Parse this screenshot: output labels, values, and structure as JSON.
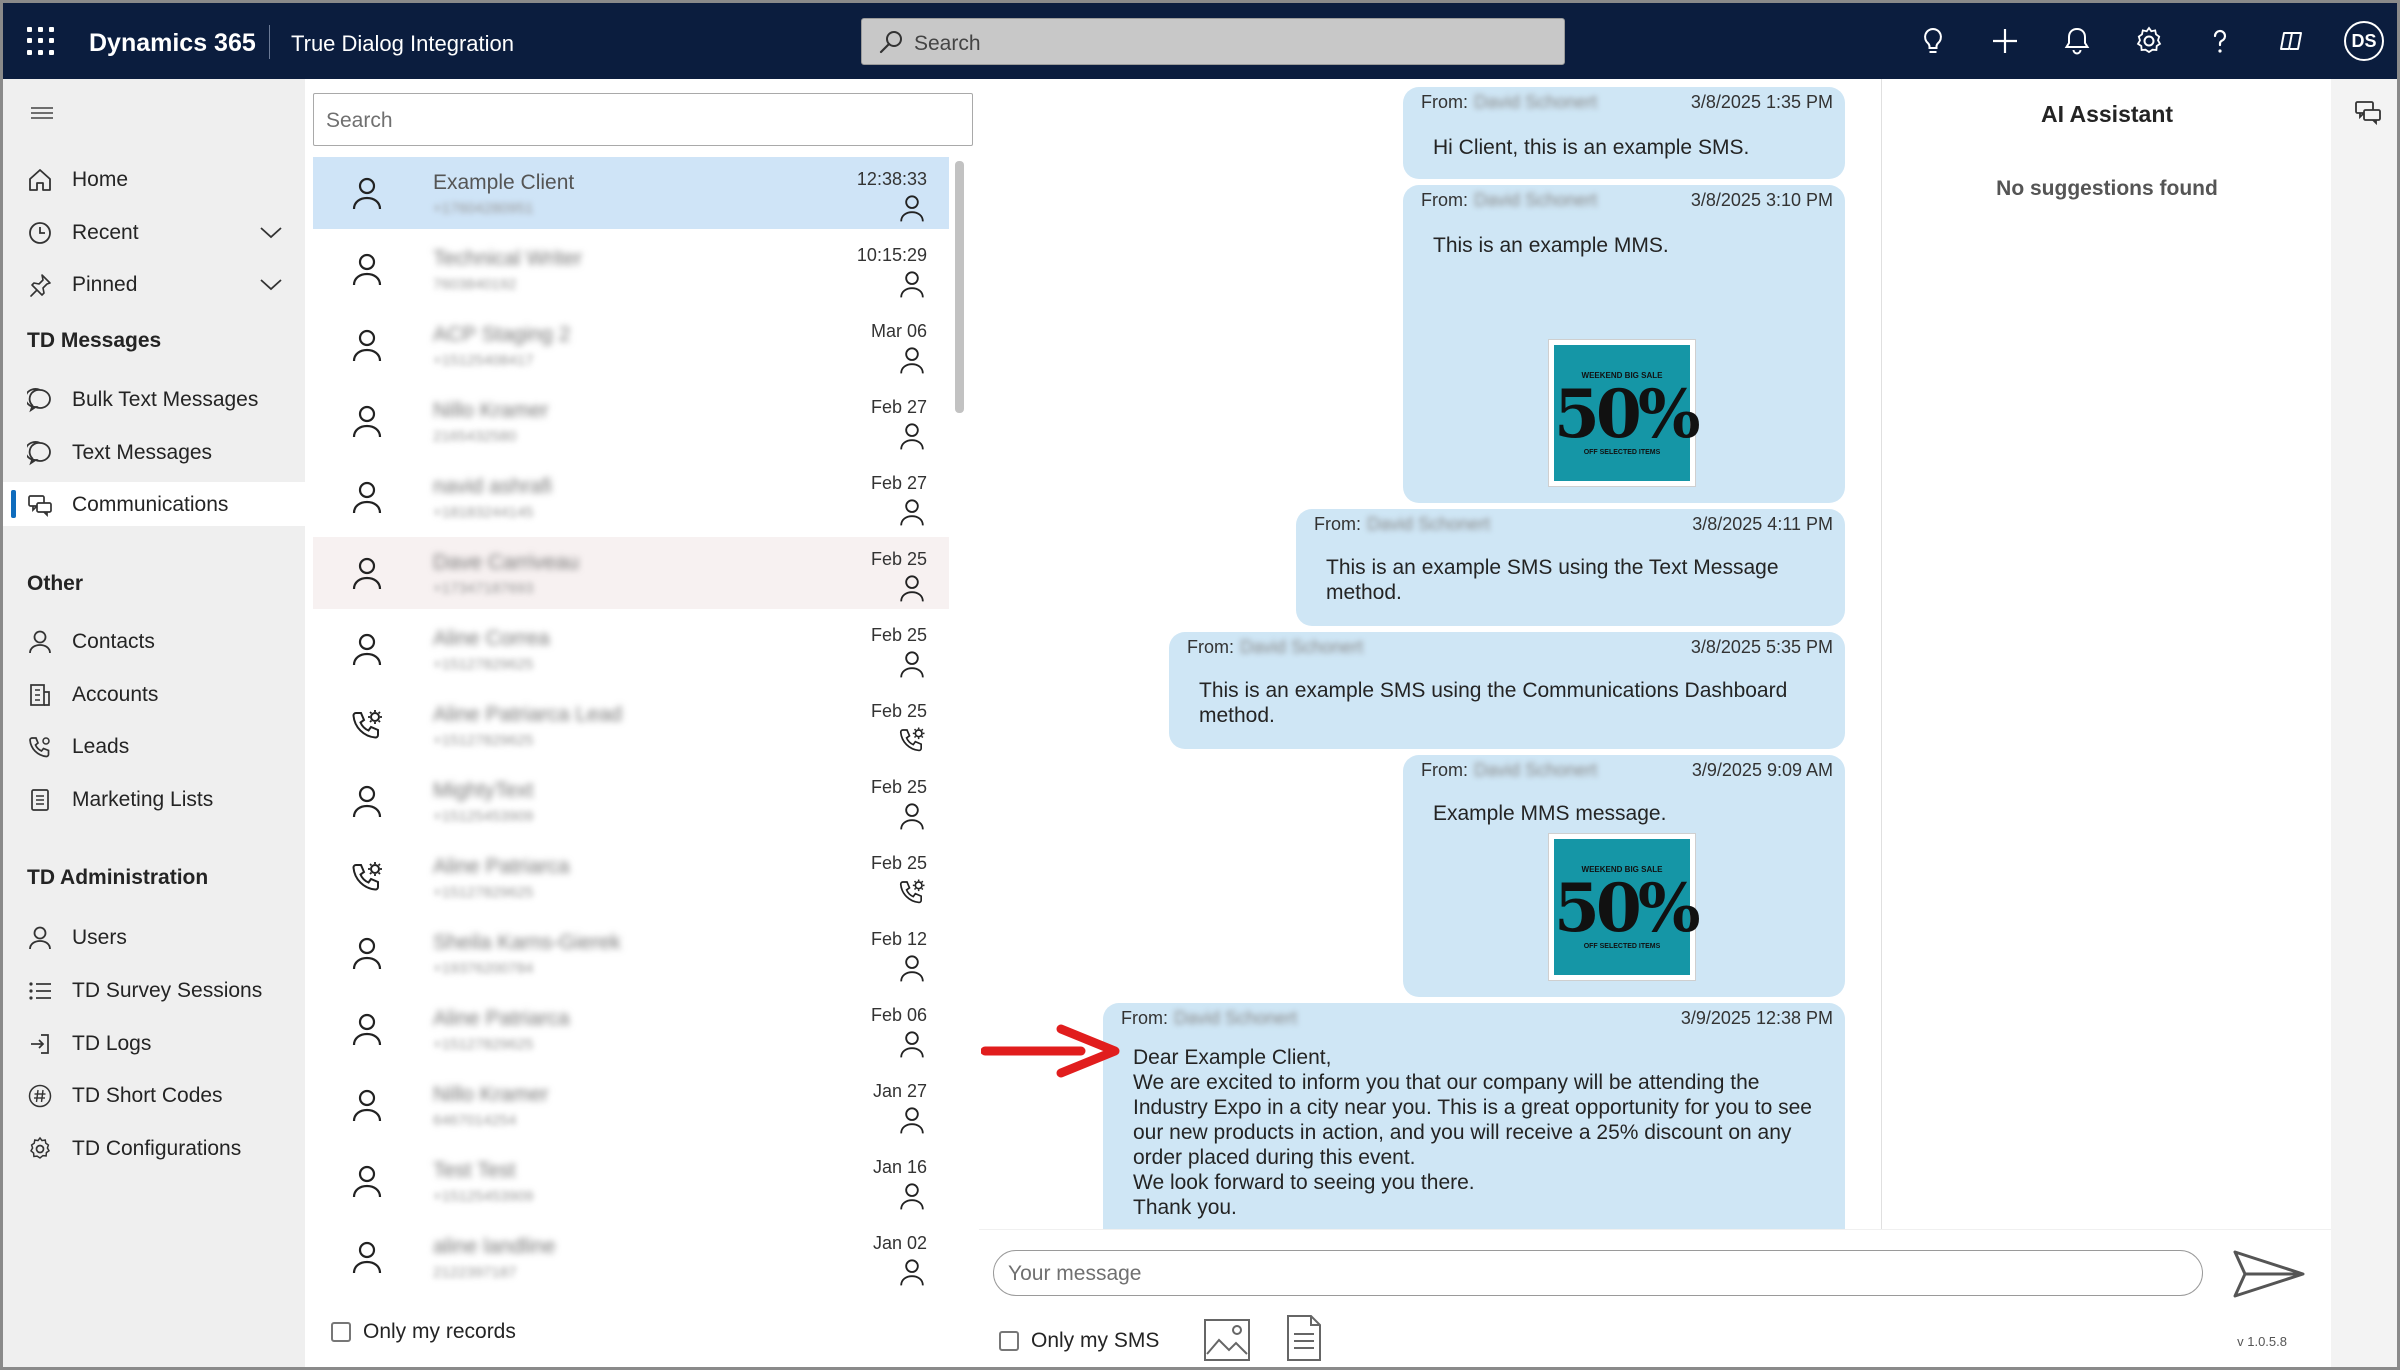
{
  "topbar": {
    "brand": "Dynamics 365",
    "app_name": "True Dialog Integration",
    "search_placeholder": "Search",
    "user_initials": "DS"
  },
  "nav": {
    "items_top": [
      {
        "label": "Home",
        "icon": "home-icon"
      },
      {
        "label": "Recent",
        "icon": "clock-icon",
        "expandable": true
      },
      {
        "label": "Pinned",
        "icon": "pin-icon",
        "expandable": true
      }
    ],
    "section_td_messages": "TD Messages",
    "items_td_messages": [
      {
        "label": "Bulk Text Messages",
        "icon": "chat-icon"
      },
      {
        "label": "Text Messages",
        "icon": "chat-icon"
      },
      {
        "label": "Communications",
        "icon": "communications-icon",
        "active": true
      }
    ],
    "section_other": "Other",
    "items_other": [
      {
        "label": "Contacts",
        "icon": "person-icon"
      },
      {
        "label": "Accounts",
        "icon": "building-icon"
      },
      {
        "label": "Leads",
        "icon": "phone-gear-icon"
      },
      {
        "label": "Marketing Lists",
        "icon": "list-doc-icon"
      }
    ],
    "section_td_admin": "TD Administration",
    "items_td_admin": [
      {
        "label": "Users",
        "icon": "person-icon"
      },
      {
        "label": "TD Survey Sessions",
        "icon": "bullet-list-icon"
      },
      {
        "label": "TD Logs",
        "icon": "sign-in-icon"
      },
      {
        "label": "TD Short Codes",
        "icon": "hash-icon"
      },
      {
        "label": "TD Configurations",
        "icon": "gear-icon"
      }
    ]
  },
  "conversations": {
    "search_placeholder": "Search",
    "items": [
      {
        "name": "Example Client",
        "phone": "+17604280951",
        "time": "12:38:33",
        "type": "contact",
        "selected": true,
        "blurred": false
      },
      {
        "name": "Technical Writer",
        "phone": "7603840192",
        "time": "10:15:29",
        "type": "contact",
        "blurred": true
      },
      {
        "name": "ACP Staging 2",
        "phone": "+15125408417",
        "time": "Mar 06",
        "type": "contact",
        "blurred": true
      },
      {
        "name": "Nillo Kramer",
        "phone": "2165432580",
        "time": "Feb 27",
        "type": "contact",
        "blurred": true
      },
      {
        "name": "navid ashrafi",
        "phone": "+18183244145",
        "time": "Feb 27",
        "type": "contact",
        "blurred": true
      },
      {
        "name": "Dave Carriveau",
        "phone": "+17347187693",
        "time": "Feb 25",
        "type": "contact",
        "blurred": true,
        "hover": true
      },
      {
        "name": "Aline Correa",
        "phone": "+15127829625",
        "time": "Feb 25",
        "type": "contact",
        "blurred": true
      },
      {
        "name": "Aline Patriarca Lead",
        "phone": "+15127829625",
        "time": "Feb 25",
        "type": "lead",
        "blurred": true
      },
      {
        "name": "MightyText",
        "phone": "+15125453909",
        "time": "Feb 25",
        "type": "contact",
        "blurred": true
      },
      {
        "name": "Aline Patriarca",
        "phone": "+15127829625",
        "time": "Feb 25",
        "type": "lead",
        "blurred": true
      },
      {
        "name": "Sheila Karns-Gierek",
        "phone": "+19376200784",
        "time": "Feb 12",
        "type": "contact",
        "blurred": true
      },
      {
        "name": "Aline Patriarca",
        "phone": "+15127829625",
        "time": "Feb 06",
        "type": "contact",
        "blurred": true
      },
      {
        "name": "Nillo Kramer",
        "phone": "6467014254",
        "time": "Jan 27",
        "type": "contact",
        "blurred": true
      },
      {
        "name": "Test Test",
        "phone": "+15125453909",
        "time": "Jan 16",
        "type": "contact",
        "blurred": true
      },
      {
        "name": "aline landline",
        "phone": "2122397187",
        "time": "Jan 02",
        "type": "contact",
        "blurred": true
      }
    ],
    "only_my_records": "Only my records"
  },
  "messages": {
    "from_label": "From:",
    "sender": "David Schonert",
    "items": [
      {
        "date": "3/8/2025 1:35 PM",
        "text": "Hi Client, this is an example SMS."
      },
      {
        "date": "3/8/2025 3:10 PM",
        "text": "This is an example MMS.",
        "image": {
          "top": "WEEKEND BIG SALE",
          "big": "50%",
          "bottom": "OFF SELECTED ITEMS"
        }
      },
      {
        "date": "3/8/2025 4:11 PM",
        "text": "This is an example SMS using the Text Message\nmethod."
      },
      {
        "date": "3/8/2025 5:35 PM",
        "text": "This is an example SMS using the Communications Dashboard\nmethod."
      },
      {
        "date": "3/9/2025 9:09 AM",
        "text": "Example MMS message.",
        "image": {
          "top": "WEEKEND BIG SALE",
          "big": "50%",
          "bottom": "OFF SELECTED ITEMS"
        }
      },
      {
        "date": "3/9/2025 12:38 PM",
        "text": "Dear Example Client,\nWe are excited to inform you that our company will be attending the\nIndustry Expo in a city near you. This is a great opportunity for you to see\nour new products in action, and you will receive a 25% discount on any\norder placed during this event.\nWe look forward to seeing you there.\nThank you."
      }
    ]
  },
  "ai_assistant": {
    "title": "AI Assistant",
    "empty_text": "No suggestions found"
  },
  "compose": {
    "placeholder": "Your message",
    "only_my_sms": "Only my SMS",
    "version": "v 1.0.5.8"
  },
  "colors": {
    "topbar": "#0b1d3e",
    "bubble": "#cfe6f5",
    "selected_row": "#cfe4f7",
    "accent": "#0f6cbd",
    "arrow": "#e11d1d",
    "mms_teal": "#1596a6"
  }
}
